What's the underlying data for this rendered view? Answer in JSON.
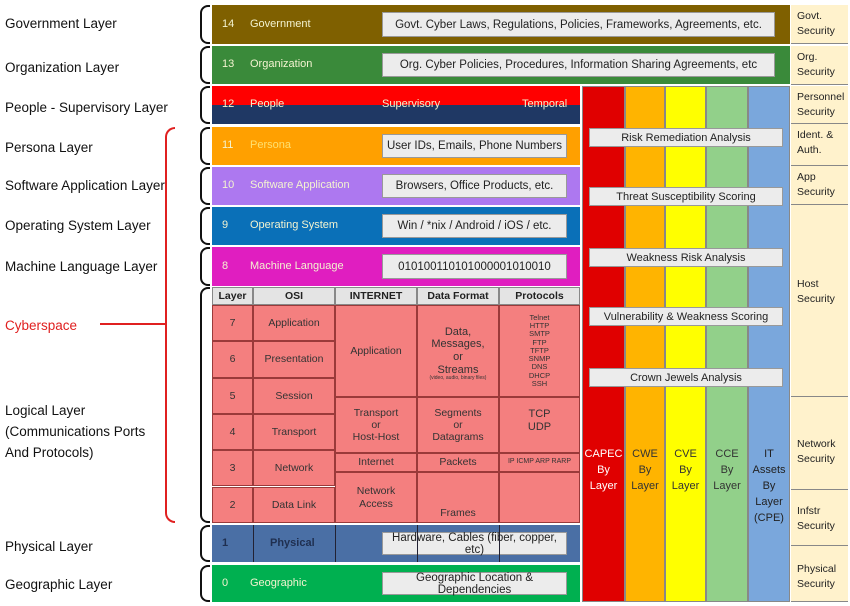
{
  "left_labels": [
    "Government Layer",
    "Organization Layer",
    "People - Supervisory Layer",
    "Persona Layer",
    "Software Application Layer",
    "Operating System Layer",
    "Machine Language Layer",
    "Cyberspace",
    "Logical Layer\n(Communications Ports\nAnd Protocols)",
    "Physical Layer",
    "Geographic Layer"
  ],
  "cyberspace_color": "#e02020",
  "layers": [
    {
      "num": "14",
      "name": "Government",
      "detail": "Govt. Cyber Laws, Regulations, Policies, Frameworks, Agreements, etc.",
      "color": "#7f6000"
    },
    {
      "num": "13",
      "name": "Organization",
      "detail": "Org. Cyber Policies, Procedures, Information Sharing Agreements, etc",
      "color": "#3a8a3a"
    },
    {
      "num": "12",
      "name": "People",
      "extra1": "Supervisory",
      "extra2": "Temporal",
      "color": "#1f3864",
      "top_color": "#ff0000"
    },
    {
      "num": "11",
      "name": "Persona",
      "detail": "User IDs, Emails,  Phone Numbers",
      "color": "#ffa000"
    },
    {
      "num": "10",
      "name": "Software Application",
      "detail": "Browsers, Office Products, etc.",
      "color": "#ad78f0"
    },
    {
      "num": "9",
      "name": "Operating System",
      "detail": "Win / *nix / Android / iOS / etc.",
      "color": "#0a70b8"
    },
    {
      "num": "8",
      "name": "Machine Language",
      "detail": "010100110101000001010010",
      "color": "#e01ec0"
    },
    {
      "num": "1",
      "name": "Physical",
      "detail": "Hardware, Cables (fiber, copper, etc)",
      "color": "#4a6fa5"
    },
    {
      "num": "0",
      "name": "Geographic",
      "detail": "Geographic Location & Dependencies",
      "color": "#00b050"
    }
  ],
  "osi": {
    "headers": [
      "Layer",
      "OSI",
      "INTERNET",
      "Data Format",
      "Protocols"
    ],
    "rows": [
      [
        "7",
        "Application"
      ],
      [
        "6",
        "Presentation"
      ],
      [
        "5",
        "Session"
      ],
      [
        "4",
        "Transport"
      ],
      [
        "3",
        "Network"
      ],
      [
        "2",
        "Data Link"
      ]
    ],
    "internet": [
      "Application",
      "Transport\nor\nHost-Host",
      "Internet",
      "Network\nAccess"
    ],
    "data_format": [
      "Data,\nMessages,\nor\nStreams",
      "(video, audio, binary files)",
      "Segments\nor\nDatagrams",
      "Packets",
      "Frames"
    ],
    "protocols": [
      "Telnet\nHTTP\nSMTP\nFTP\nTFTP\nSNMP\nDNS\nDHCP\nSSH",
      "TCP\nUDP",
      "IP ICMP ARP RARP",
      ""
    ],
    "fill": "#f47f7f"
  },
  "bars": [
    {
      "label": "CAPEC\nBy\nLayer",
      "color": "#e00000",
      "text": "#ffffff"
    },
    {
      "label": "CWE\nBy\nLayer",
      "color": "#ffb400",
      "text": "#333333"
    },
    {
      "label": "CVE\nBy\nLayer",
      "color": "#ffff00",
      "text": "#333333"
    },
    {
      "label": "CCE\nBy\nLayer",
      "color": "#92d08a",
      "text": "#333333"
    },
    {
      "label": "IT\nAssets\nBy\nLayer\n(CPE)",
      "color": "#7aa7dc",
      "text": "#222222"
    }
  ],
  "analyses": [
    "Risk Remediation Analysis",
    "Threat Susceptibility Scoring",
    "Weakness Risk Analysis",
    "Vulnerability & Weakness Scoring",
    "Crown Jewels Analysis"
  ],
  "security": [
    "Govt.\nSecurity",
    "Org.\nSecurity",
    "Personnel\nSecurity",
    "Ident. &\nAuth.",
    "App\nSecurity",
    "Host\nSecurity",
    "Network\nSecurity",
    "Infstr\nSecurity",
    "Physical\nSecurity"
  ]
}
